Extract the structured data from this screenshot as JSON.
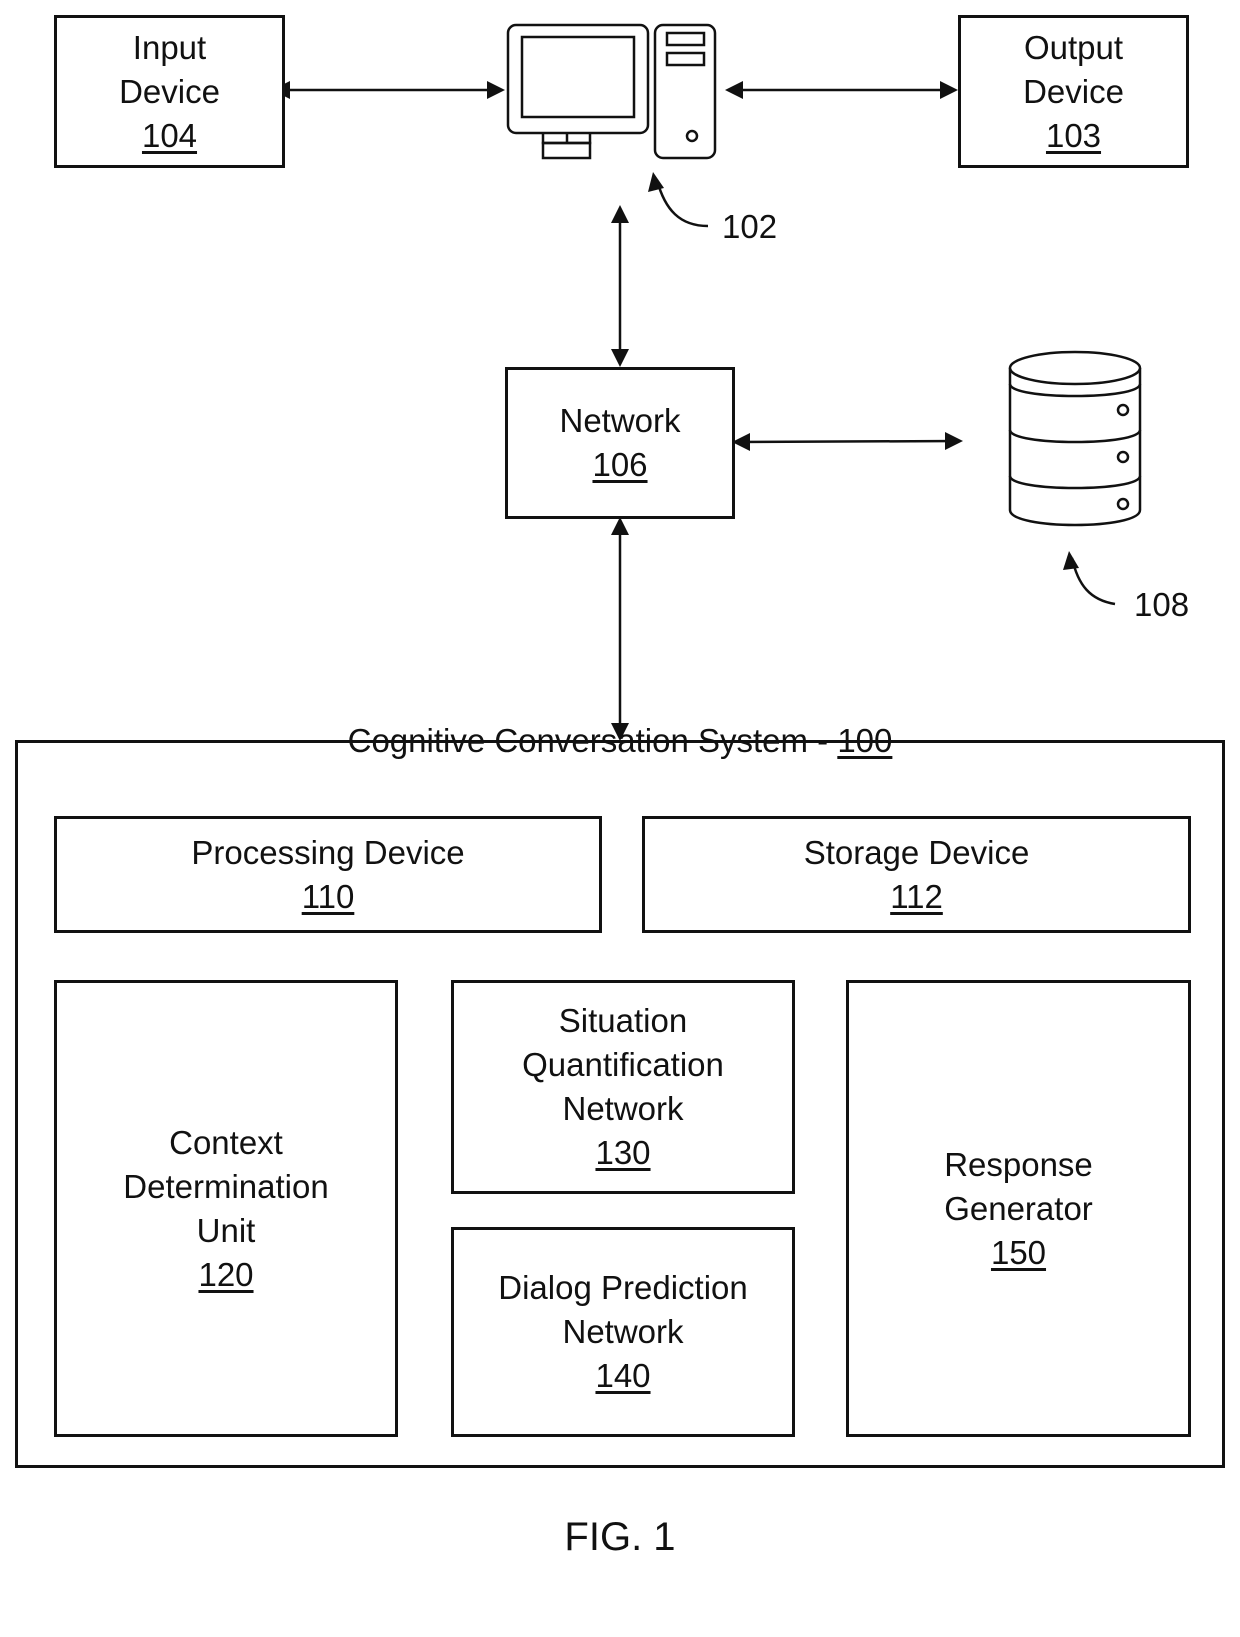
{
  "figure_label": "FIG. 1",
  "nodes": {
    "input_device": {
      "label_line1": "Input",
      "label_line2": "Device",
      "ref": "104"
    },
    "output_device": {
      "label_line1": "Output",
      "label_line2": "Device",
      "ref": "103"
    },
    "computer": {
      "ref": "102",
      "icon": "computer-icon"
    },
    "network": {
      "label": "Network",
      "ref": "106"
    },
    "database": {
      "ref": "108",
      "icon": "database-icon"
    },
    "system": {
      "title": "Cognitive Conversation System - ",
      "ref": "100"
    },
    "processing_device": {
      "label": "Processing Device",
      "ref": "110"
    },
    "storage_device": {
      "label": "Storage Device",
      "ref": "112"
    },
    "context_unit": {
      "line1": "Context",
      "line2": "Determination",
      "line3": "Unit",
      "ref": "120"
    },
    "situation_network": {
      "line1": "Situation",
      "line2": "Quantification",
      "line3": "Network",
      "ref": "130"
    },
    "dialog_network": {
      "line1": "Dialog Prediction",
      "line2": "Network",
      "ref": "140"
    },
    "response_generator": {
      "line1": "Response",
      "line2": "Generator",
      "ref": "150"
    }
  },
  "connections": [
    {
      "from": "input_device",
      "to": "computer",
      "type": "bidirectional"
    },
    {
      "from": "computer",
      "to": "output_device",
      "type": "bidirectional"
    },
    {
      "from": "computer",
      "to": "network",
      "type": "bidirectional"
    },
    {
      "from": "network",
      "to": "database",
      "type": "bidirectional"
    },
    {
      "from": "network",
      "to": "system",
      "type": "bidirectional"
    }
  ]
}
